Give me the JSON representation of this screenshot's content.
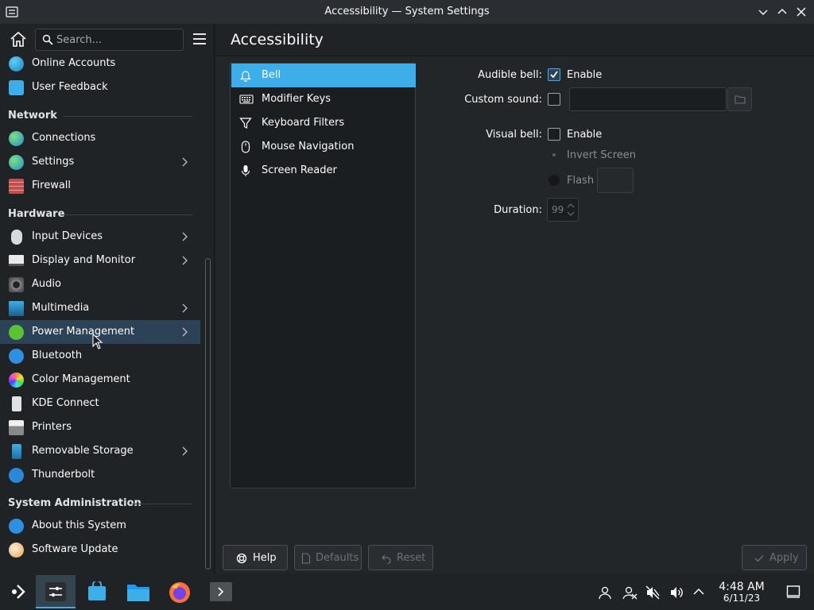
{
  "window": {
    "title": "Accessibility — System Settings"
  },
  "sidebar": {
    "search_placeholder": "Search...",
    "items": [
      {
        "label": "Online Accounts",
        "icon": "online-accounts-icon"
      },
      {
        "label": "User Feedback",
        "icon": "user-feedback-icon"
      },
      {
        "section": "Network"
      },
      {
        "label": "Connections",
        "icon": "connections-icon"
      },
      {
        "label": "Settings",
        "icon": "network-settings-icon",
        "has_children": true
      },
      {
        "label": "Firewall",
        "icon": "firewall-icon"
      },
      {
        "section": "Hardware"
      },
      {
        "label": "Input Devices",
        "icon": "input-devices-icon",
        "has_children": true
      },
      {
        "label": "Display and Monitor",
        "icon": "display-icon",
        "has_children": true
      },
      {
        "label": "Audio",
        "icon": "audio-icon"
      },
      {
        "label": "Multimedia",
        "icon": "multimedia-icon",
        "has_children": true
      },
      {
        "label": "Power Management",
        "icon": "power-icon",
        "has_children": true,
        "highlighted": true
      },
      {
        "label": "Bluetooth",
        "icon": "bluetooth-icon"
      },
      {
        "label": "Color Management",
        "icon": "color-management-icon"
      },
      {
        "label": "KDE Connect",
        "icon": "kde-connect-icon"
      },
      {
        "label": "Printers",
        "icon": "printer-icon"
      },
      {
        "label": "Removable Storage",
        "icon": "removable-storage-icon",
        "has_children": true
      },
      {
        "label": "Thunderbolt",
        "icon": "thunderbolt-icon"
      },
      {
        "section": "System Administration"
      },
      {
        "label": "About this System",
        "icon": "info-icon"
      },
      {
        "label": "Software Update",
        "icon": "software-update-icon"
      }
    ],
    "sections": {
      "network": "Network",
      "hardware": "Hardware",
      "sysadmin": "System Administration"
    },
    "labels": {
      "online_accounts": "Online Accounts",
      "user_feedback": "User Feedback",
      "connections": "Connections",
      "settings": "Settings",
      "firewall": "Firewall",
      "input_devices": "Input Devices",
      "display_monitor": "Display and Monitor",
      "audio": "Audio",
      "multimedia": "Multimedia",
      "power_management": "Power Management",
      "bluetooth": "Bluetooth",
      "color_management": "Color Management",
      "kde_connect": "KDE Connect",
      "printers": "Printers",
      "removable_storage": "Removable Storage",
      "thunderbolt": "Thunderbolt",
      "about_system": "About this System",
      "software_update": "Software Update"
    }
  },
  "page": {
    "title": "Accessibility",
    "categories": [
      {
        "label": "Bell",
        "icon": "bell-icon",
        "selected": true
      },
      {
        "label": "Modifier Keys",
        "icon": "keyboard-icon"
      },
      {
        "label": "Keyboard Filters",
        "icon": "filter-icon"
      },
      {
        "label": "Mouse Navigation",
        "icon": "mouse-icon"
      },
      {
        "label": "Screen Reader",
        "icon": "microphone-icon"
      }
    ],
    "form": {
      "audible_bell_label": "Audible bell:",
      "audible_bell_enable": "Enable",
      "audible_bell_checked": true,
      "custom_sound_label": "Custom sound:",
      "custom_sound_checked": false,
      "custom_sound_value": "",
      "visual_bell_label": "Visual bell:",
      "visual_bell_enable": "Enable",
      "visual_bell_checked": false,
      "invert_screen_label": "Invert Screen",
      "flash_label": "Flash",
      "duration_label": "Duration:",
      "duration_value": "99"
    }
  },
  "buttons": {
    "help": "Help",
    "defaults": "Defaults",
    "reset": "Reset",
    "apply": "Apply"
  },
  "taskbar": {
    "time": "4:48 AM",
    "date": "6/11/23"
  },
  "colors": {
    "accent": "#3daee9",
    "highlight_row": "#2b4257",
    "window_bg": "#232629"
  }
}
